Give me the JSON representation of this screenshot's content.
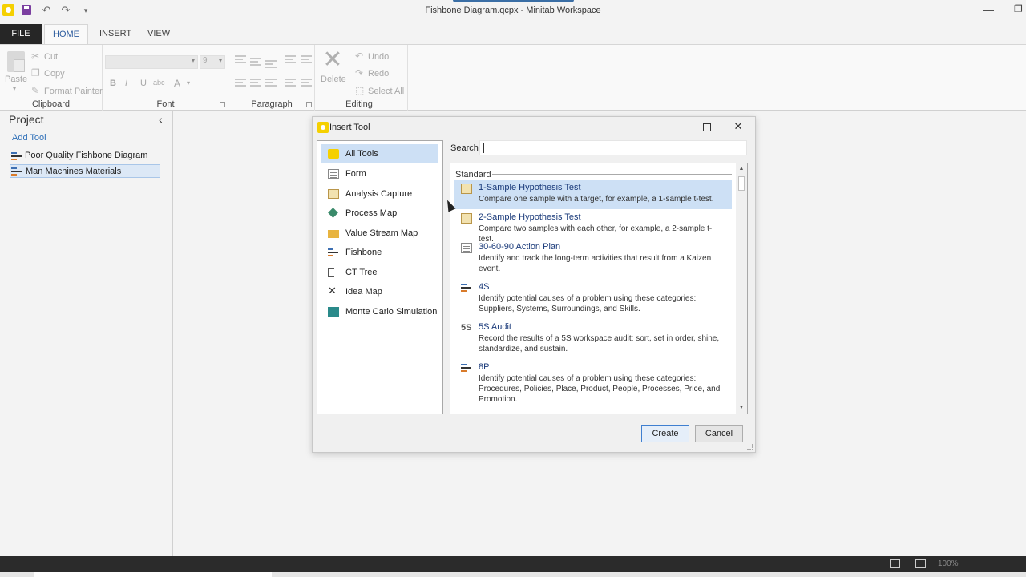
{
  "window": {
    "title": "Fishbone Diagram.qcpx - Minitab Workspace",
    "quick_access_more": "▾"
  },
  "ribbon_tabs": [
    "FILE",
    "HOME",
    "INSERT",
    "VIEW"
  ],
  "ribbon": {
    "clipboard": {
      "paste": "Paste",
      "cut": "Cut",
      "copy": "Copy",
      "format_painter": "Format Painter",
      "label": "Clipboard"
    },
    "font": {
      "size": "9",
      "bold": "B",
      "italic": "I",
      "underline": "U",
      "strike": "abc",
      "color": "A",
      "label": "Font"
    },
    "paragraph": {
      "label": "Paragraph"
    },
    "editing": {
      "delete": "Delete",
      "undo": "Undo",
      "redo": "Redo",
      "select_all": "Select All",
      "label": "Editing"
    }
  },
  "project": {
    "title": "Project",
    "add_tool": "Add Tool",
    "items": [
      {
        "label": "Poor Quality Fishbone Diagram"
      },
      {
        "label": "Man Machines Materials"
      }
    ]
  },
  "dialog": {
    "title": "Insert Tool",
    "search_label": "Search:",
    "search_value": "",
    "categories": [
      {
        "label": "All Tools",
        "icon": "all-tools-icon"
      },
      {
        "label": "Form",
        "icon": "form-icon"
      },
      {
        "label": "Analysis Capture",
        "icon": "analysis-capture-icon"
      },
      {
        "label": "Process Map",
        "icon": "process-map-icon"
      },
      {
        "label": "Value Stream Map",
        "icon": "value-stream-map-icon"
      },
      {
        "label": "Fishbone",
        "icon": "fishbone-icon"
      },
      {
        "label": "CT Tree",
        "icon": "ct-tree-icon"
      },
      {
        "label": "Idea Map",
        "icon": "idea-map-icon"
      },
      {
        "label": "Monte Carlo Simulation",
        "icon": "monte-carlo-icon"
      }
    ],
    "section": "Standard",
    "tools": [
      {
        "name": "1-Sample Hypothesis Test",
        "desc": "Compare one sample with a target, for example, a 1-sample t-test."
      },
      {
        "name": "2-Sample Hypothesis Test",
        "desc": "Compare two samples with each other, for example, a 2-sample t-test."
      },
      {
        "name": "30-60-90 Action Plan",
        "desc": "Identify and track the long-term activities that result from a Kaizen event."
      },
      {
        "name": "4S",
        "desc": "Identify potential causes of a problem using these categories: Suppliers, Systems, Surroundings, and Skills."
      },
      {
        "name": "5S Audit",
        "desc": "Record the results of a 5S workspace audit: sort, set in order, shine, standardize, and sustain.",
        "icon_text": "5S"
      },
      {
        "name": "8P",
        "desc": "Identify potential causes of a problem using these categories: Procedures, Policies, Place, Product, People, Processes, Price, and Promotion."
      }
    ],
    "create": "Create",
    "cancel": "Cancel"
  },
  "statusbar": {
    "zoom": "100%"
  },
  "colors": {
    "accent": "#2e5d9f",
    "selection": "#cde0f5",
    "file_tab": "#262626"
  }
}
